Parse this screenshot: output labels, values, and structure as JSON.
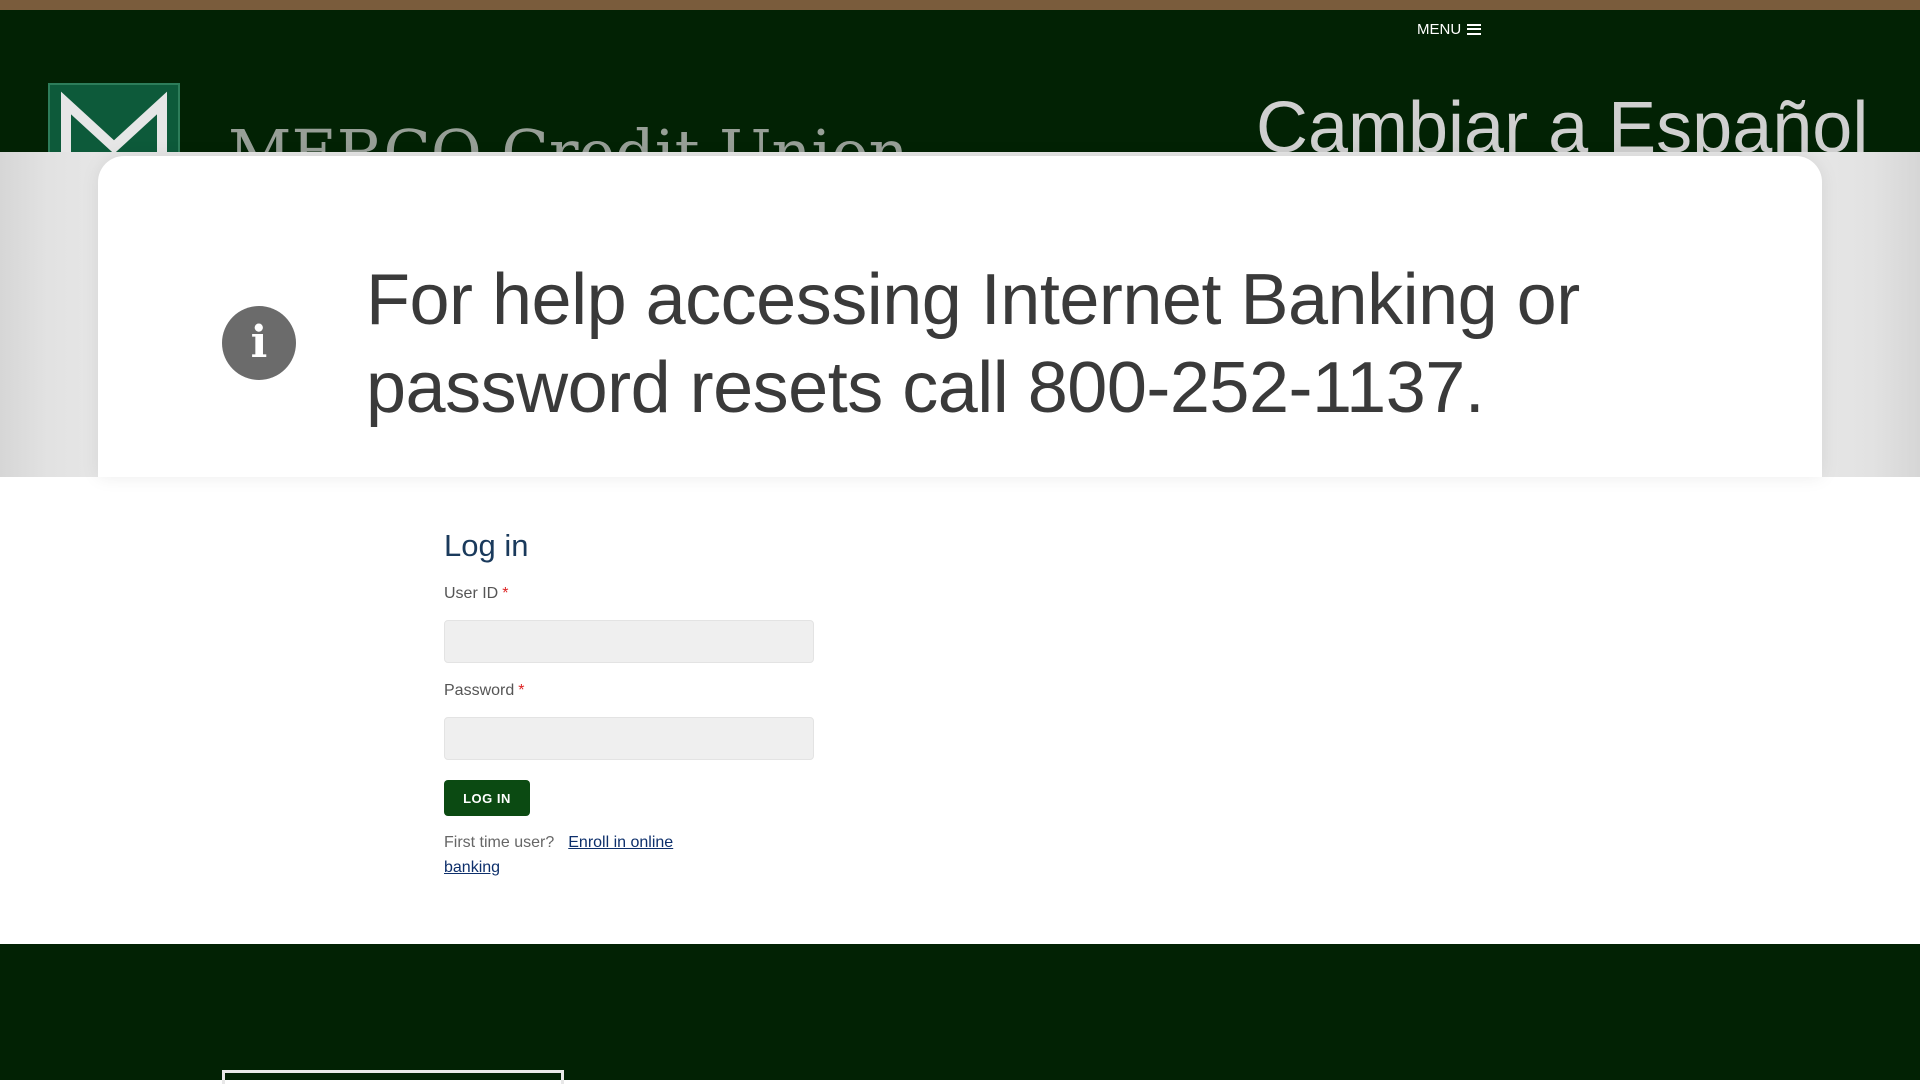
{
  "header": {
    "menu_label": "MENU",
    "logo_text": "MERCO Credit Union",
    "language_link": "Cambiar a Español"
  },
  "notice": {
    "text": "For help accessing Internet Banking or password resets call 800-252-1137."
  },
  "login": {
    "title": "Log in",
    "user_id_label": "User ID",
    "password_label": "Password",
    "required_marker": "*",
    "button_label": "LOG IN",
    "first_time_text": "First time user?",
    "enroll_link": "Enroll in online banking"
  },
  "colors": {
    "header_bg": "#022204",
    "top_strip": "#7a5c3c",
    "button_bg": "#0b4a12",
    "title_color": "#1a3a5c",
    "link_color": "#0d2f6b",
    "required_color": "#dd2222"
  },
  "icons": {
    "menu": "hamburger-icon",
    "notice": "info-icon"
  }
}
